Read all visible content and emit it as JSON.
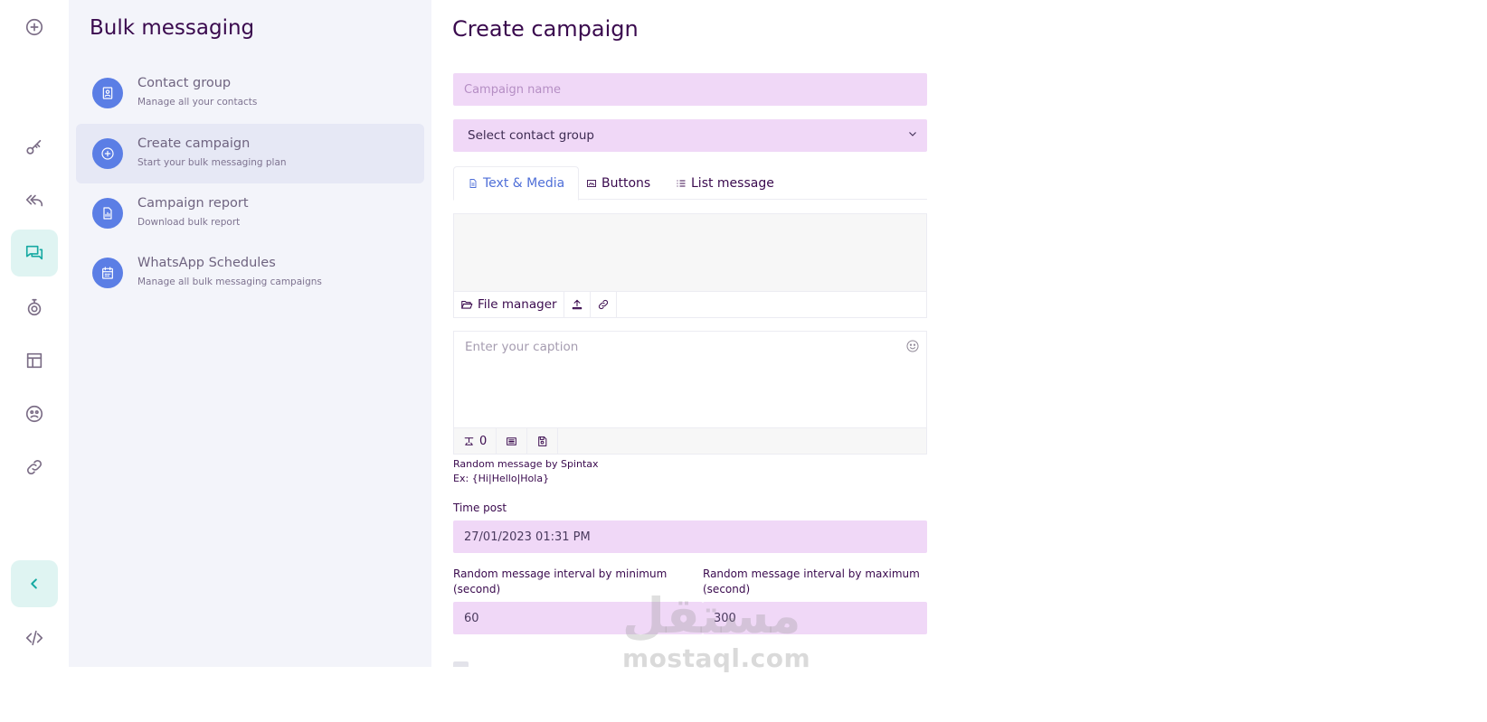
{
  "rail": {
    "items": [
      {
        "name": "add-circle-icon"
      },
      {
        "name": "key-icon"
      },
      {
        "name": "reply-all-icon"
      },
      {
        "name": "chat-icon",
        "active": true
      },
      {
        "name": "robot-icon"
      },
      {
        "name": "layout-icon"
      },
      {
        "name": "emoji-icon"
      },
      {
        "name": "link-icon"
      },
      {
        "name": "chevron-left-icon"
      },
      {
        "name": "code-icon"
      }
    ]
  },
  "subnav": {
    "title": "Bulk messaging",
    "items": [
      {
        "label": "Contact group",
        "desc": "Manage all your contacts",
        "icon": "contact-book-icon"
      },
      {
        "label": "Create campaign",
        "desc": "Start your bulk messaging plan",
        "icon": "plus-circle-icon",
        "active": true
      },
      {
        "label": "Campaign report",
        "desc": "Download bulk report",
        "icon": "report-icon"
      },
      {
        "label": "WhatsApp Schedules",
        "desc": "Manage all bulk messaging campaigns",
        "icon": "calendar-icon"
      }
    ]
  },
  "main": {
    "title": "Create campaign",
    "campaign_name_placeholder": "Campaign name",
    "contact_group_select": "Select contact group",
    "tabs": [
      {
        "label": "Text & Media",
        "icon": "document-icon",
        "active": true
      },
      {
        "label": "Buttons",
        "icon": "image-icon"
      },
      {
        "label": "List message",
        "icon": "list-icon"
      }
    ],
    "media_toolbar": {
      "file_manager": "File manager"
    },
    "caption_placeholder": "Enter your caption",
    "caption_counter": "0",
    "spintax_hint": "Random message by Spintax",
    "spintax_example": "Ex: {Hi|Hello|Hola}",
    "time_post_label": "Time post",
    "time_post_value": "27/01/2023 01:31 PM",
    "interval_min_label": "Random message interval by minimum (second)",
    "interval_min_value": "60",
    "interval_max_label": "Random message interval by maximum (second)",
    "interval_max_value": "300"
  },
  "watermark": {
    "arabic": "مستقل",
    "latin": "mostaql.com"
  },
  "colors": {
    "accent": "#16a9a2",
    "nav_icon_bg": "#5b7ee5",
    "field_bg": "#f0d8f7",
    "title_color": "#3a0a4e",
    "tab_active": "#4f6fd8"
  }
}
